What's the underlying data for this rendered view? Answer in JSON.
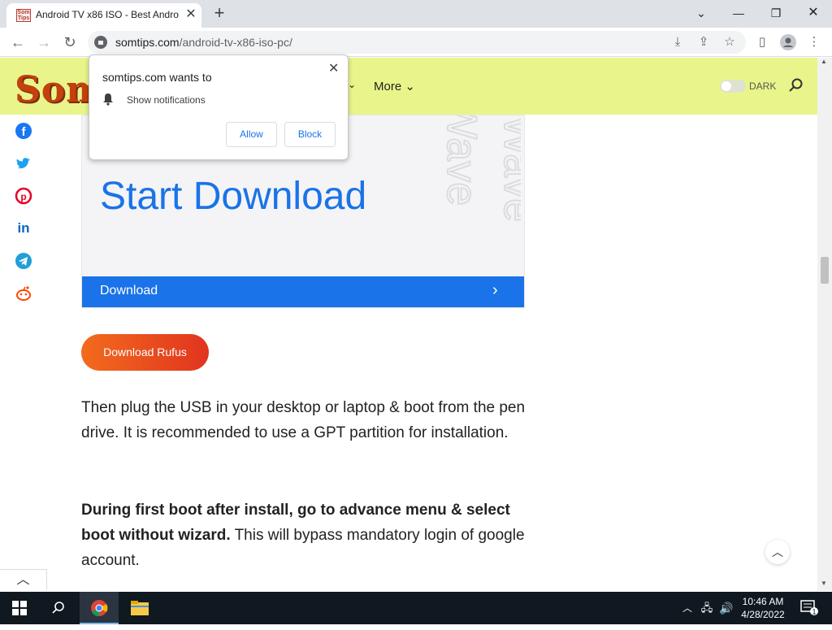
{
  "browser": {
    "tab_title": "Android TV x86 ISO - Best Andro",
    "favicon_text": "Som Tips",
    "url_domain": "somtips.com",
    "url_path": "/android-tv-x86-iso-pc/"
  },
  "site": {
    "logo": "Som",
    "nav_more": "More",
    "dark_label": "DARK"
  },
  "social": [
    "facebook-icon",
    "twitter-icon",
    "pinterest-icon",
    "linkedin-icon",
    "telegram-icon",
    "reddit-icon"
  ],
  "ad": {
    "headline": "Start Download",
    "watermark": "Wave",
    "bar_label": "Download"
  },
  "content": {
    "rufus_button": "Download Rufus",
    "para1": "Then plug the USB in your desktop or laptop & boot from the pen drive. It is recommended to use a GPT partition for installation.",
    "para2_bold": "During first boot after install, go to advance menu & select boot without wizard.",
    "para2_rest": " This will bypass mandatory login of google account."
  },
  "notification": {
    "heading": "somtips.com wants to",
    "permission": "Show notifications",
    "allow": "Allow",
    "block": "Block"
  },
  "taskbar": {
    "time": "10:46 AM",
    "date": "4/28/2022",
    "notif_count": "1"
  },
  "colors": {
    "header_bg": "#e9f58a",
    "ad_blue": "#1a73e8",
    "rufus_orange": "#f26b1d"
  }
}
